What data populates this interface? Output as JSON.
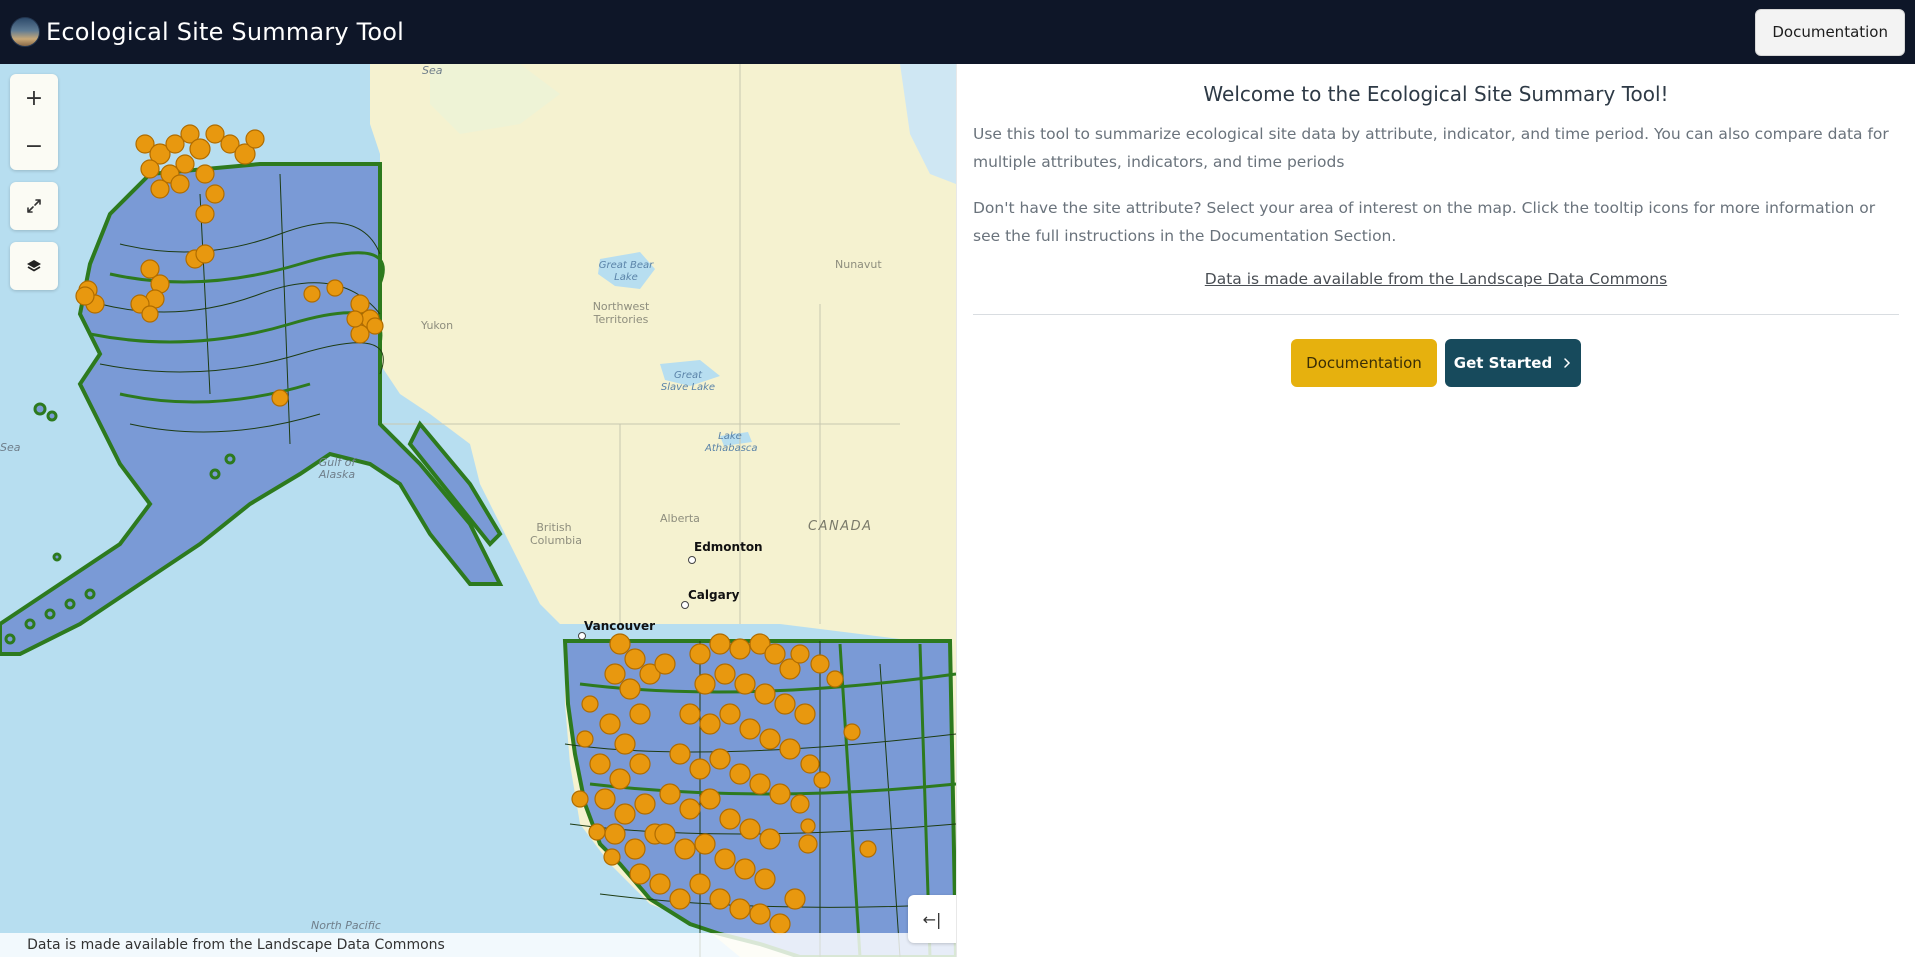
{
  "header": {
    "title": "Ecological Site Summary Tool",
    "documentation_label": "Documentation",
    "logo_icon": "globe-logo"
  },
  "map": {
    "controls": {
      "zoom_in": "+",
      "zoom_out": "−",
      "fullscreen_icon": "expand-icon",
      "layers_icon": "layers-icon"
    },
    "attribution": "Data is made available from the Landscape Data Commons",
    "collapse_label": "←|",
    "labels": {
      "sea_top": "Sea",
      "sea_left": "Sea",
      "gulf": "Gulf of Alaska",
      "yukon": "Yukon",
      "nwt": "Northwest Territories",
      "nunavut": "Nunavut",
      "great_bear": "Great Bear Lake",
      "great_slave": "Great Slave Lake",
      "athabasca": "Lake Athabasca",
      "bc": "British Columbia",
      "alberta": "Alberta",
      "canada": "CANADA",
      "north_pacific": "North Pacific"
    },
    "cities": {
      "edmonton": "Edmonton",
      "calgary": "Calgary",
      "vancouver": "Vancouver"
    },
    "colors": {
      "ocean": "#b7def0",
      "land": "#f5f2d0",
      "polygon_fill": "#7a9ad6",
      "polygon_stroke": "#2d7a1e",
      "site_points": "#e8980f"
    }
  },
  "panel": {
    "welcome": "Welcome to the Ecological Site Summary Tool!",
    "intro": "Use this tool to summarize ecological site data by attribute, indicator, and time period. You can also compare data for multiple attributes, indicators, and time periods",
    "help": "Don't have the site attribute? Select your area of interest on the map. Click the tooltip icons for more information or see the full instructions in the Documentation Section.",
    "data_link": "Data is made available from the Landscape Data Commons",
    "documentation_label": "Documentation",
    "get_started_label": "Get Started",
    "get_started_icon": "chevron-right-icon"
  }
}
